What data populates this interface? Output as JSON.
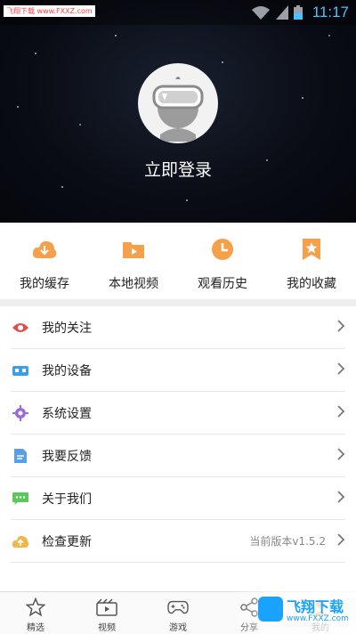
{
  "status_bar": {
    "brand": "飞翔下载 www.FXXZ.com",
    "time": "11:17",
    "signal_icon": "wifi-icon",
    "battery_icon": "battery-icon"
  },
  "profile": {
    "login_text": "立即登录",
    "avatar_icon": "vr-headset-avatar-icon"
  },
  "quick_actions": [
    {
      "label": "我的缓存",
      "icon": "cloud-download-icon"
    },
    {
      "label": "本地视频",
      "icon": "folder-play-icon"
    },
    {
      "label": "观看历史",
      "icon": "clock-icon"
    },
    {
      "label": "我的收藏",
      "icon": "star-bookmark-icon"
    }
  ],
  "menu": [
    {
      "label": "我的关注",
      "icon": "eye-icon",
      "value": ""
    },
    {
      "label": "我的设备",
      "icon": "vr-glasses-icon",
      "value": ""
    },
    {
      "label": "系统设置",
      "icon": "gear-icon",
      "value": ""
    },
    {
      "label": "我要反馈",
      "icon": "document-edit-icon",
      "value": ""
    },
    {
      "label": "关于我们",
      "icon": "chat-bubble-icon",
      "value": ""
    },
    {
      "label": "检查更新",
      "icon": "cloud-update-icon",
      "value": "当前版本v1.5.2"
    }
  ],
  "bottom_nav": [
    {
      "label": "精选",
      "icon": "star-outline-icon"
    },
    {
      "label": "视频",
      "icon": "film-icon"
    },
    {
      "label": "游戏",
      "icon": "gamepad-icon"
    },
    {
      "label": "分享",
      "icon": "share-icon"
    },
    {
      "label": "我的",
      "icon": "user-icon"
    }
  ],
  "watermark": {
    "title": "飞翔下载",
    "url": "www.FXXZ.com"
  },
  "colors": {
    "accent_orange": "#f5a04a",
    "eye_red": "#e0504a",
    "vr_blue": "#3c9ee6",
    "gear_purple": "#9b6bd6",
    "doc_blue": "#5a9ee6",
    "chat_green": "#5ac85a",
    "update_yellow": "#f0b848",
    "time_blue": "#49c3ff"
  }
}
